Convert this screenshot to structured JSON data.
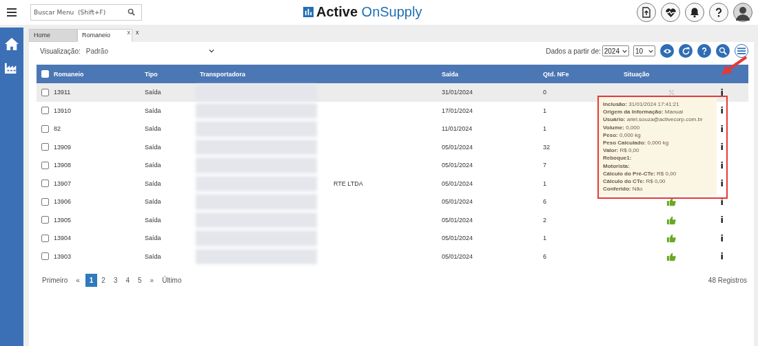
{
  "header": {
    "search": {
      "placeholder": "Buscar Menu  (Shift+F)"
    },
    "logo": {
      "word_1": "Active",
      "word_2": "OnSupply"
    }
  },
  "tabs": [
    {
      "label": "Home",
      "selected": false
    },
    {
      "label": "Romaneio",
      "selected": true,
      "close": "x"
    }
  ],
  "tab_close": "x",
  "toolbar": {
    "view_label": "Visualização:",
    "view_value": "Padrão",
    "from_label": "Dados a partir de:",
    "year": "2024",
    "page_size": "10"
  },
  "table": {
    "all_checked": false,
    "columns": [
      "Romaneio",
      "Tipo",
      "Transportadora",
      "Saída",
      "Qtd. NFe",
      "Situação"
    ],
    "rows": [
      {
        "checked": false,
        "hover": true,
        "romaneio": "13911",
        "tipo": "Saída",
        "saida": "31/01/2024",
        "qtd": "0",
        "kind": "pending",
        "info": "i"
      },
      {
        "checked": false,
        "hover": false,
        "romaneio": "13910",
        "tipo": "Saída",
        "saida": "17/01/2024",
        "qtd": "1",
        "kind": "covered",
        "info": "i"
      },
      {
        "checked": false,
        "hover": false,
        "romaneio": "82",
        "tipo": "Saída",
        "saida": "11/01/2024",
        "qtd": "1",
        "kind": "covered",
        "info": "i"
      },
      {
        "checked": false,
        "hover": false,
        "romaneio": "13909",
        "tipo": "Saída",
        "saida": "05/01/2024",
        "qtd": "32",
        "kind": "covered",
        "info": "i"
      },
      {
        "checked": false,
        "hover": false,
        "romaneio": "13908",
        "tipo": "Saída",
        "saida": "05/01/2024",
        "qtd": "7",
        "kind": "covered",
        "info": "i"
      },
      {
        "checked": false,
        "hover": false,
        "romaneio": "13907",
        "tipo": "Saída",
        "transportadora": "RTE LTDA",
        "saida": "05/01/2024",
        "qtd": "1",
        "kind": "covered",
        "info": "i"
      },
      {
        "checked": false,
        "hover": false,
        "romaneio": "13906",
        "tipo": "Saída",
        "saida": "05/01/2024",
        "qtd": "6",
        "kind": "approved",
        "info": "i"
      },
      {
        "checked": false,
        "hover": false,
        "romaneio": "13905",
        "tipo": "Saída",
        "saida": "05/01/2024",
        "qtd": "2",
        "kind": "approved",
        "info": "i"
      },
      {
        "checked": false,
        "hover": false,
        "romaneio": "13904",
        "tipo": "Saída",
        "saida": "05/01/2024",
        "qtd": "1",
        "kind": "approved",
        "info": "i"
      },
      {
        "checked": false,
        "hover": false,
        "romaneio": "13903",
        "tipo": "Saída",
        "saida": "05/01/2024",
        "qtd": "6",
        "kind": "approved",
        "info": "i"
      }
    ]
  },
  "tooltip": [
    {
      "label": "Inclusão:",
      "value": "31/01/2024 17:41:21"
    },
    {
      "label": "Origem da Informação:",
      "value": "Manual"
    },
    {
      "label": "Usuário:",
      "value": "ariel.souza@activecorp.com.br"
    },
    {
      "label": "Volume:",
      "value": "0,000"
    },
    {
      "label": "Peso:",
      "value": "0,000 kg"
    },
    {
      "label": "Peso Calculado:",
      "value": "0,000 kg"
    },
    {
      "label": "Valor:",
      "value": "R$ 0,00"
    },
    {
      "label": "Reboque1:"
    },
    {
      "label": "Motorista:"
    },
    {
      "label": "Cálculo do Pré-CTe:",
      "value": "R$ 0,00"
    },
    {
      "label": "Cálculo do CTe:",
      "value": "R$ 0,00"
    },
    {
      "label": "Conferido:",
      "value": "Não"
    }
  ],
  "pagination": {
    "first": "Primeiro",
    "prev": "«",
    "pages": [
      {
        "label": "1",
        "selected": true
      },
      {
        "label": "2",
        "selected": false
      },
      {
        "label": "3",
        "selected": false
      },
      {
        "label": "4",
        "selected": false
      },
      {
        "label": "5",
        "selected": false
      }
    ],
    "next": "»",
    "last": "Último",
    "total": "48 Registros"
  }
}
